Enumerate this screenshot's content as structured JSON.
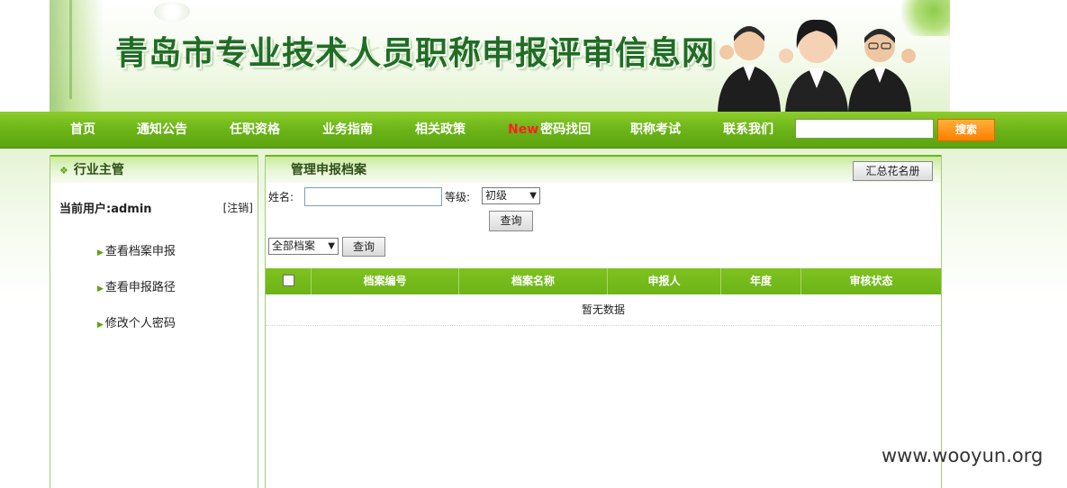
{
  "header": {
    "site_title": "青岛市专业技术人员职称申报评审信息网"
  },
  "nav": {
    "items": [
      "首页",
      "通知公告",
      "任职资格",
      "业务指南",
      "相关政策"
    ],
    "password_new_tag": "New",
    "password_label": "密码找回",
    "items_after": [
      "职称考试",
      "联系我们"
    ],
    "search_value": "",
    "search_button": "搜索"
  },
  "sidebar": {
    "title": "行业主管",
    "current_user_label": "当前用户:admin",
    "logout_label": "[注销]",
    "menu": [
      "查看档案申报",
      "查看申报路径",
      "修改个人密码"
    ]
  },
  "main": {
    "title": "管理申报档案",
    "roster_button": "汇总花名册",
    "name_label": "姓名:",
    "name_value": "",
    "level_label": "等级:",
    "level_selected": "初级",
    "query_button": "查询",
    "archive_filter_selected": "全部档案",
    "query_button_2": "查询",
    "table": {
      "columns": [
        "档案编号",
        "档案名称",
        "申报人",
        "年度",
        "审核状态"
      ],
      "empty_text": "暂无数据"
    }
  },
  "watermark": "www.wooyun.org"
}
